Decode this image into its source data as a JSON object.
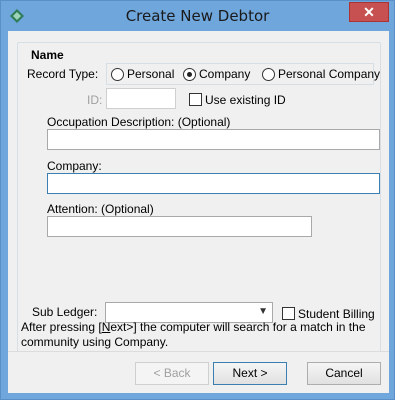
{
  "window": {
    "title": "Create New Debtor",
    "close_glyph": "✕",
    "icon": "app-diamond-icon"
  },
  "group": {
    "legend": "Name",
    "record_type_label": "Record Type:",
    "record_types": [
      {
        "label": "Personal",
        "selected": false
      },
      {
        "label": "Company",
        "selected": true
      },
      {
        "label": "Personal Company",
        "selected": false
      }
    ],
    "id_label": "ID:",
    "id_value": "",
    "use_existing_id_label": "Use existing ID",
    "use_existing_id_checked": false,
    "occupation_label": "Occupation Description: (Optional)",
    "occupation_value": "",
    "company_label": "Company:",
    "company_value": "",
    "attention_label": "Attention:  (Optional)",
    "attention_value": "",
    "sub_ledger_label": "Sub Ledger:",
    "sub_ledger_value": "",
    "student_billing_label": "Student Billing",
    "student_billing_checked": false
  },
  "info": {
    "part1": "After pressing [",
    "part_u": "N",
    "part2": "ext>] the computer will search for a match in the community using Company."
  },
  "buttons": {
    "back": "< Back",
    "next": "Next >",
    "cancel": "Cancel"
  },
  "colors": {
    "title_bar": "#6fa6dc",
    "close": "#c75050",
    "focus_border": "#3c7fb1"
  }
}
